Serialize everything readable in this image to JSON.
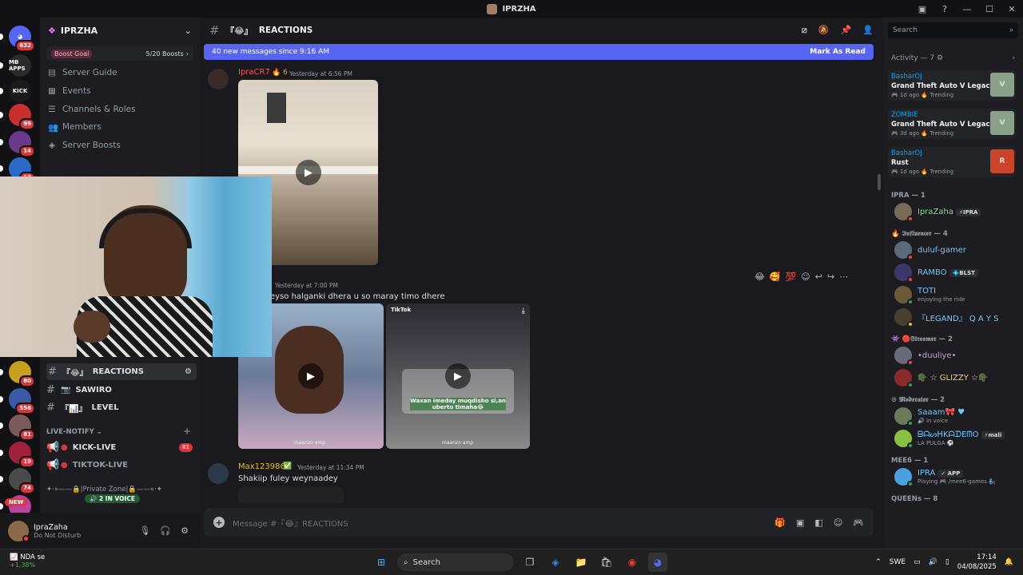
{
  "window": {
    "title": "IPRZHA"
  },
  "servers": {
    "items": [
      {
        "name": "home",
        "badge": "632",
        "color": "#5865f2",
        "label": "◕"
      },
      {
        "name": "mb-apps",
        "badge": "",
        "color": "#2a2a2a",
        "label": "MB APPS"
      },
      {
        "name": "kick",
        "badge": "",
        "color": "#1a1a1a",
        "label": "KICK"
      },
      {
        "name": "server-4",
        "badge": "99",
        "color": "#c83030",
        "label": ""
      },
      {
        "name": "server-5",
        "badge": "14",
        "color": "#6a3a8a",
        "label": ""
      },
      {
        "name": "server-6",
        "badge": "12",
        "color": "#2a6ac8",
        "label": ""
      },
      {
        "name": "server-7",
        "badge": "80",
        "color": "#c8a020",
        "label": ""
      },
      {
        "name": "server-8",
        "badge": "556",
        "color": "#3a5aa8",
        "label": ""
      },
      {
        "name": "server-9",
        "badge": "81",
        "color": "#7a5a5a",
        "label": ""
      },
      {
        "name": "server-10",
        "badge": "19",
        "color": "#a02040",
        "label": ""
      },
      {
        "name": "server-11",
        "badge": "74",
        "color": "#4a4a4a",
        "label": ""
      },
      {
        "name": "server-12",
        "badge": "",
        "color": "#c040a0",
        "label": ""
      }
    ],
    "new_label": "NEW"
  },
  "sidebar": {
    "server_name": "IPRZHA",
    "boost_goal": "Boost Goal",
    "boost_count": "5/20 Boosts",
    "menu": [
      "Server Guide",
      "Events",
      "Channels & Roles",
      "Members",
      "Server Boosts"
    ],
    "channels": [
      {
        "name": "REACTIONS",
        "prefix": "『😂』"
      },
      {
        "name": "SAWIRO",
        "prefix": "📷"
      },
      {
        "name": "LEVEL",
        "prefix": "『📊』"
      }
    ],
    "category": "LIVE-NOTIFY",
    "live": [
      {
        "name": "KICK-LIVE",
        "badge": "81"
      },
      {
        "name": "TIKTOK-LIVE",
        "badge": ""
      }
    ],
    "private_zone": "✦·»——🔒|Private Zone|🔒——«·✦",
    "in_voice": "2 IN VOICE"
  },
  "user": {
    "name": "IpraZaha",
    "status": "Do Not Disturb"
  },
  "channel": {
    "name": "REACTIONS",
    "prefix": "『😂』",
    "new_messages": "40 new messages since 9:16 AM",
    "mark_read": "Mark As Read",
    "composer_placeholder": "Message #『😂』REACTIONS"
  },
  "messages": [
    {
      "author": "IpraCR7",
      "extra": "🔥 6",
      "time": "Yesterday at 6:56 PM",
      "color": "#f05a5a"
    },
    {
      "author": "",
      "time": "Yesterday at 7:00 PM",
      "text": "eyso halganki dhera u so maray timo dhere"
    },
    {
      "author": "Max123986",
      "extra": "✅",
      "time": "Yesterday at 11:34 PM",
      "text": "Shakiip fuley weynaadey",
      "color": "#e0c020"
    }
  ],
  "tiktok": {
    "brand": "TikTok",
    "caption": "Waxan imeday muqdisho si,an uberto timaha😂",
    "watermark": "maanzo·amp"
  },
  "right": {
    "search_placeholder": "Search",
    "activity_header": "Activity — 7 ⚙",
    "activities": [
      {
        "user": "BasharOJ",
        "game": "Grand Theft Auto V Legacy",
        "meta": "🎮 1d ago  🔥 Trending",
        "thumb": "V",
        "thumbColor": "#8aa08a"
      },
      {
        "user": "ZOMBIE",
        "game": "Grand Theft Auto V Legacy",
        "meta": "🎮 3d ago  🔥 Trending",
        "thumb": "V",
        "thumbColor": "#8aa08a"
      },
      {
        "user": "BasharOJ",
        "game": "Rust",
        "meta": "🎮 1d ago  🔥 Trending",
        "thumb": "R",
        "thumbColor": "#c8452a"
      }
    ],
    "groups": [
      {
        "title": "IPRA — 1",
        "members": [
          {
            "name": "IpraZaha",
            "tag": "⚡IPRA",
            "color": "#7ee07e",
            "sub": "",
            "av": "#7a6a5a",
            "status": "#f23f43"
          }
        ]
      },
      {
        "title": "🔥 𝕴𝖓𝖋𝖑𝖚𝖊𝖓𝖈𝖊𝖗 — 4",
        "members": [
          {
            "name": "duluf-gamer",
            "tag": "",
            "color": "#6ec8ff",
            "sub": "",
            "av": "#5a6a7a",
            "status": "#f23f43"
          },
          {
            "name": "RAMBO",
            "tag": "💠BLST",
            "color": "#6ec8ff",
            "sub": "",
            "av": "#3a3a6a",
            "status": "#f23f43"
          },
          {
            "name": "TOTI",
            "tag": "",
            "color": "#6ec8ff",
            "sub": "enjoying the ride",
            "av": "#6a5a3a",
            "status": "#23a55a"
          },
          {
            "name": "『LEGAND』 Q A Y S",
            "tag": "",
            "color": "#6ec8ff",
            "sub": "",
            "av": "#4a4030",
            "status": "#f0b232"
          }
        ]
      },
      {
        "title": "👾 🔴𝕾𝖙𝖗𝖊𝖆𝖒𝖊𝖗 — 2",
        "members": [
          {
            "name": "•duuliye•",
            "tag": "",
            "color": "#c8a0e0",
            "sub": "",
            "av": "#6a6a7a",
            "status": "#f23f43"
          },
          {
            "name": "🪖 ☆ GLIZZY ☆🪖",
            "tag": "",
            "color": "#f0d060",
            "sub": "",
            "av": "#8a2a2a",
            "status": "#23a55a"
          }
        ]
      },
      {
        "title": "⊙ 𝕸𝖔𝖉𝖊𝖗𝖆𝖙𝖔𝖗 — 2",
        "members": [
          {
            "name": "Saaam🎀 ♥",
            "tag": "",
            "color": "#6ec8ff",
            "sub": "🔊 In voice",
            "av": "#6a7a5a",
            "status": "#23a55a"
          },
          {
            "name": "ᗷᗩᔕᕼKᗩᗪEᗰO",
            "tag": "⚡mali",
            "color": "#6ec8ff",
            "sub": "LA PULGA ⚽",
            "av": "#8ac040",
            "status": "#23a55a"
          }
        ]
      },
      {
        "title": "MEE6 — 1",
        "members": [
          {
            "name": "IPRA",
            "tag": "✓ APP",
            "color": "#6ec8ff",
            "sub": "Playing 🎮 /mee6-games 🧞",
            "av": "#4aa0e0",
            "status": "#23a55a"
          }
        ]
      },
      {
        "title": "QUEENs — 8",
        "members": []
      }
    ]
  },
  "taskbar": {
    "ticker": "NDA se",
    "change": "+1,38%",
    "search": "Search",
    "lang": "SWE",
    "time": "17:14",
    "date": "04/08/2025"
  }
}
